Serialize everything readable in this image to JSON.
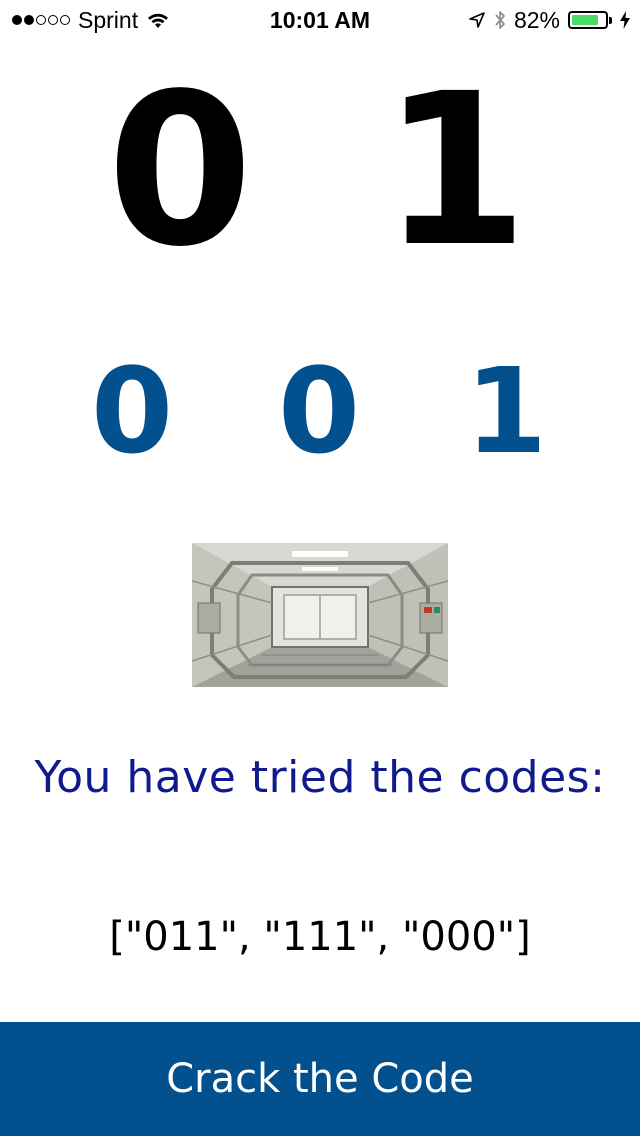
{
  "status_bar": {
    "carrier": "Sprint",
    "signal_bars_filled": 2,
    "signal_bars_total": 5,
    "time": "10:01 AM",
    "battery_percent_label": "82%",
    "battery_level": 0.82,
    "icons": [
      "wifi-icon",
      "location-arrow-icon",
      "bluetooth-icon",
      "battery-icon",
      "charging-bolt-icon"
    ]
  },
  "target_digits": [
    "0",
    "1"
  ],
  "entry_digits": [
    "0",
    "0",
    "1"
  ],
  "image": {
    "name": "spaceship-corridor-image"
  },
  "tried": {
    "heading": "You have tried the codes:",
    "codes": "[\"011\", \"111\", \"000\"]"
  },
  "action_button": {
    "label": "Crack the Code"
  },
  "colors": {
    "background": "#ffffff",
    "target_digit": "#000000",
    "entry_digit": "#03508f",
    "heading": "#101a8c",
    "button_background": "#03508f",
    "button_text": "#ffffff",
    "battery_fill": "#4cd964"
  }
}
